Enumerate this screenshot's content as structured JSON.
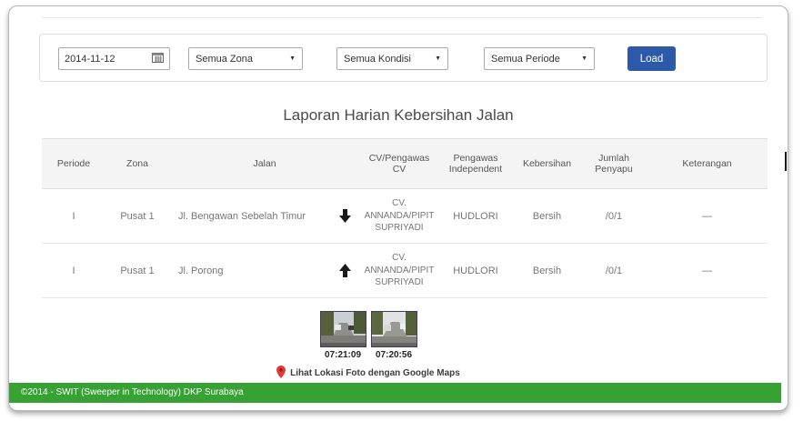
{
  "colors": {
    "accent_blue": "#2d5aa8",
    "footer_green": "#36a233",
    "pin_red": "#e53935"
  },
  "icons": {
    "select_caret": "▼"
  },
  "toolbar": {
    "date_value": "2014-11-12",
    "zona_selected": "Semua Zona",
    "kondisi_selected": "Semua Kondisi",
    "periode_selected": "Semua Periode",
    "load_label": "Load"
  },
  "page_title": "Laporan Harian Kebersihan Jalan",
  "table": {
    "headers": [
      "Periode",
      "Zona",
      "Jalan",
      "CV/Pengawas CV",
      "Pengawas Independent",
      "Kebersihan",
      "Jumlah Penyapu",
      "Keterangan"
    ],
    "rows": [
      {
        "periode": "I",
        "zona": "Pusat 1",
        "jalan": "Jl. Bengawan Sebelah Timur",
        "arrow": "down",
        "cv_pengawas": "CV. ANNANDA/PIPIT SUPRIYADI",
        "pengawas_independent": "HUDLORI",
        "kebersihan": "Bersih",
        "jumlah_penyapu": "/0/1",
        "keterangan": "—"
      },
      {
        "periode": "I",
        "zona": "Pusat 1",
        "jalan": "Jl. Porong",
        "arrow": "up",
        "cv_pengawas": "CV. ANNANDA/PIPIT SUPRIYADI",
        "pengawas_independent": "HUDLORI",
        "kebersihan": "Bersih",
        "jumlah_penyapu": "/0/1",
        "keterangan": "—"
      }
    ],
    "photo_detail": {
      "photos": [
        {
          "time": "07:21:09"
        },
        {
          "time": "07:20:56"
        }
      ],
      "maps_link_label": "Lihat Lokasi Foto dengan Google Maps"
    }
  },
  "footer": {
    "copyright": "©2014 - SWIT (Sweeper in Technology) DKP Surabaya"
  }
}
